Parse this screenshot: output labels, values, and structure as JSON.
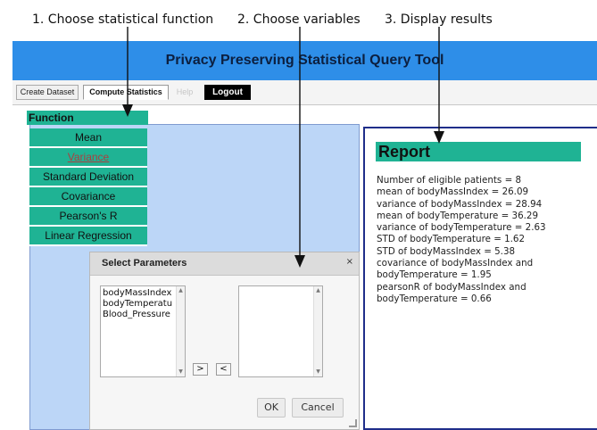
{
  "annotations": {
    "step1": "1. Choose statistical function",
    "step2": "2. Choose variables",
    "step3": "3. Display results"
  },
  "app": {
    "title": "Privacy Preserving Statistical Query Tool"
  },
  "tabs": [
    {
      "label": "Create Dataset"
    },
    {
      "label": "Compute Statistics"
    },
    {
      "label": "Help"
    },
    {
      "label": "Logout"
    }
  ],
  "function_panel": {
    "header": "Function",
    "items": [
      {
        "label": "Mean"
      },
      {
        "label": "Variance",
        "selected": true
      },
      {
        "label": "Standard Deviation"
      },
      {
        "label": "Covariance"
      },
      {
        "label": "Pearson's R"
      },
      {
        "label": "Linear Regression"
      }
    ]
  },
  "dialog": {
    "title": "Select Parameters",
    "close_glyph": "×",
    "variables": [
      "bodyMassIndex",
      "bodyTemperatu",
      "Blood_Pressure"
    ],
    "add_label": ">",
    "remove_label": "<",
    "ok_label": "OK",
    "cancel_label": "Cancel"
  },
  "report": {
    "title": "Report",
    "lines": [
      "Number of eligible patients = 8",
      "mean of bodyMassIndex = 26.09",
      "variance of bodyMassIndex = 28.94",
      "mean of bodyTemperature = 36.29",
      "variance of bodyTemperature = 2.63",
      "STD of bodyTemperature = 1.62",
      "STD of bodyMassIndex = 5.38",
      "covariance of bodyMassIndex and",
      "bodyTemperature = 1.95",
      "pearsonR of bodyMassIndex and",
      "bodyTemperature = 0.66"
    ]
  },
  "colors": {
    "banner": "#2e8ee8",
    "accent_green": "#1fb394",
    "panel_blue": "#bcd6f7",
    "report_border": "#1f2e8a"
  }
}
